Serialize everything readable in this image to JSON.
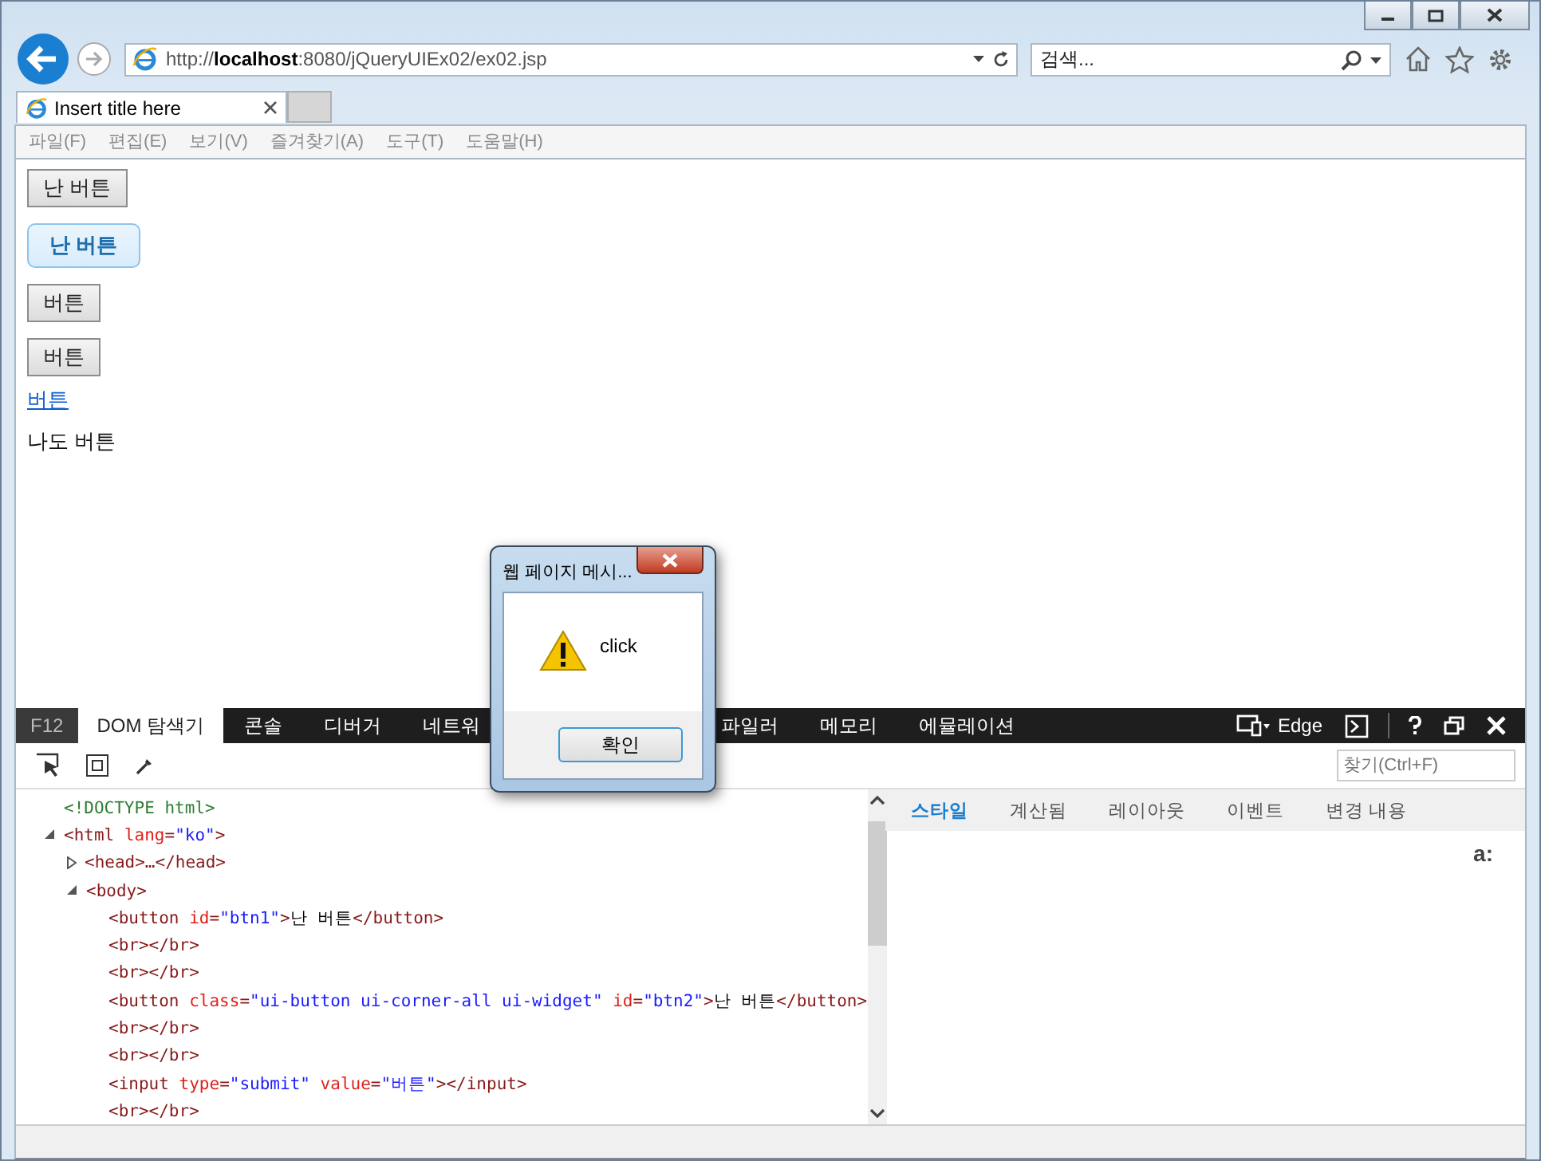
{
  "browser": {
    "address": "http://**localhost**:8080/jQueryUIEx02/ex02.jsp",
    "search": {
      "placeholder": "검색..."
    },
    "tab": {
      "title": "Insert title here"
    }
  },
  "menu": [
    "파일(F)",
    "편집(E)",
    "보기(V)",
    "즐겨찾기(A)",
    "도구(T)",
    "도움말(H)"
  ],
  "page": [
    {
      "kind": "button",
      "label": "난 버튼"
    },
    {
      "kind": "ui-button",
      "label": "난 버튼"
    },
    {
      "kind": "button",
      "label": "버튼"
    },
    {
      "kind": "button",
      "label": "버튼"
    },
    {
      "kind": "link",
      "label": "버튼"
    },
    {
      "kind": "text",
      "label": "나도 버튼"
    }
  ],
  "dialog": {
    "title": "웹 페이지 메시...",
    "message": "click",
    "button": "확인"
  },
  "devtools": {
    "key_label": "F12",
    "tabs": [
      {
        "label": "DOM 탐색기",
        "selected": true
      },
      {
        "label": "콘솔",
        "selected": false
      },
      {
        "label": "디버거",
        "selected": false
      },
      {
        "label": "네트워",
        "selected": false
      },
      {
        "label": "파일러",
        "selected": false
      },
      {
        "label": "메모리",
        "selected": false
      },
      {
        "label": "에뮬레이션",
        "selected": false
      }
    ],
    "mode": "Edge",
    "find": {
      "placeholder": "찾기(Ctrl+F)"
    },
    "tree": [
      {
        "tokens": [
          {
            "kind": "doctype",
            "text": "<!DOCTYPE html>"
          }
        ]
      },
      {
        "expanded": true,
        "tokens": [
          {
            "kind": "tag",
            "text": "<html "
          },
          {
            "kind": "attr",
            "text": "lang"
          },
          {
            "kind": "tag",
            "text": "="
          },
          {
            "kind": "value",
            "text": "\"ko\""
          },
          {
            "kind": "tag",
            "text": ">"
          }
        ],
        "children": [
          {
            "expanded": false,
            "tokens": [
              {
                "kind": "tag",
                "text": "<head>…</head>"
              }
            ]
          },
          {
            "expanded": true,
            "tokens": [
              {
                "kind": "tag",
                "text": "<body>"
              }
            ],
            "children": [
              {
                "tokens": [
                  {
                    "kind": "tag",
                    "text": "<button "
                  },
                  {
                    "kind": "attr",
                    "text": "id"
                  },
                  {
                    "kind": "tag",
                    "text": "="
                  },
                  {
                    "kind": "value",
                    "text": "\"btn1\""
                  },
                  {
                    "kind": "tag",
                    "text": ">"
                  },
                  {
                    "kind": "text",
                    "text": "난 버튼"
                  },
                  {
                    "kind": "tag",
                    "text": "</button>"
                  }
                ]
              },
              {
                "tokens": [
                  {
                    "kind": "tag",
                    "text": "<br></br>"
                  }
                ]
              },
              {
                "tokens": [
                  {
                    "kind": "tag",
                    "text": "<br></br>"
                  }
                ]
              },
              {
                "tokens": [
                  {
                    "kind": "tag",
                    "text": "<button "
                  },
                  {
                    "kind": "attr",
                    "text": "class"
                  },
                  {
                    "kind": "tag",
                    "text": "="
                  },
                  {
                    "kind": "value",
                    "text": "\"ui-button ui-corner-all ui-widget\" "
                  },
                  {
                    "kind": "attr",
                    "text": "id"
                  },
                  {
                    "kind": "tag",
                    "text": "="
                  },
                  {
                    "kind": "value",
                    "text": "\"btn2\""
                  },
                  {
                    "kind": "tag",
                    "text": ">"
                  },
                  {
                    "kind": "text",
                    "text": "난 버튼"
                  },
                  {
                    "kind": "tag",
                    "text": "</button>"
                  }
                ]
              },
              {
                "tokens": [
                  {
                    "kind": "tag",
                    "text": "<br></br>"
                  }
                ]
              },
              {
                "tokens": [
                  {
                    "kind": "tag",
                    "text": "<br></br>"
                  }
                ]
              },
              {
                "tokens": [
                  {
                    "kind": "tag",
                    "text": "<input "
                  },
                  {
                    "kind": "attr",
                    "text": "type"
                  },
                  {
                    "kind": "tag",
                    "text": "="
                  },
                  {
                    "kind": "value",
                    "text": "\"submit\" "
                  },
                  {
                    "kind": "attr",
                    "text": "value"
                  },
                  {
                    "kind": "tag",
                    "text": "="
                  },
                  {
                    "kind": "value",
                    "text": "\"버튼\""
                  },
                  {
                    "kind": "tag",
                    "text": "></input>"
                  }
                ]
              },
              {
                "tokens": [
                  {
                    "kind": "tag",
                    "text": "<br></br>"
                  }
                ]
              }
            ]
          }
        ]
      }
    ],
    "style_tabs": [
      {
        "label": "스타일",
        "selected": true
      },
      {
        "label": "계산됨",
        "selected": false
      },
      {
        "label": "레이아웃",
        "selected": false
      },
      {
        "label": "이벤트",
        "selected": false
      },
      {
        "label": "변경 내용",
        "selected": false
      }
    ],
    "style_text": "a:"
  }
}
